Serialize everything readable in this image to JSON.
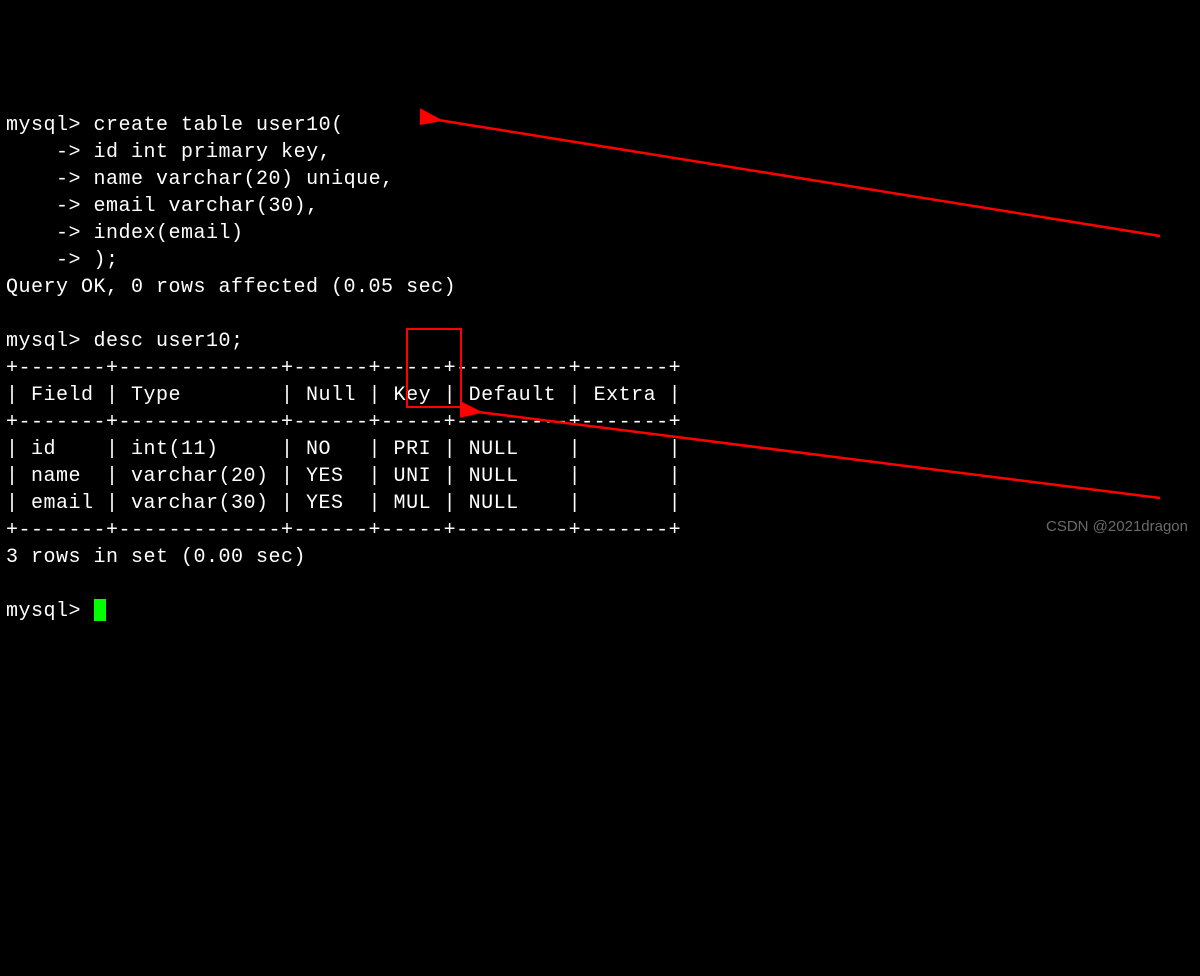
{
  "prompt": "mysql>",
  "continuation": "    ->",
  "create_stmt": {
    "line1": "create table user10(",
    "line2": "id int primary key,",
    "line3": "name varchar(20) unique,",
    "line4": "email varchar(30),",
    "line5": "index(email)",
    "line6": ");"
  },
  "query_ok": "Query OK, 0 rows affected (0.05 sec)",
  "desc_cmd": "desc user10;",
  "table": {
    "sep": "+-------+-------------+------+-----+---------+-------+",
    "header": "| Field | Type        | Null | Key | Default | Extra |",
    "rows": [
      "| id    | int(11)     | NO   | PRI | NULL    |       |",
      "| name  | varchar(20) | YES  | UNI | NULL    |       |",
      "| email | varchar(30) | YES  | MUL | NULL    |       |"
    ]
  },
  "rows_result": "3 rows in set (0.00 sec)",
  "watermark": "CSDN @2021dragon"
}
